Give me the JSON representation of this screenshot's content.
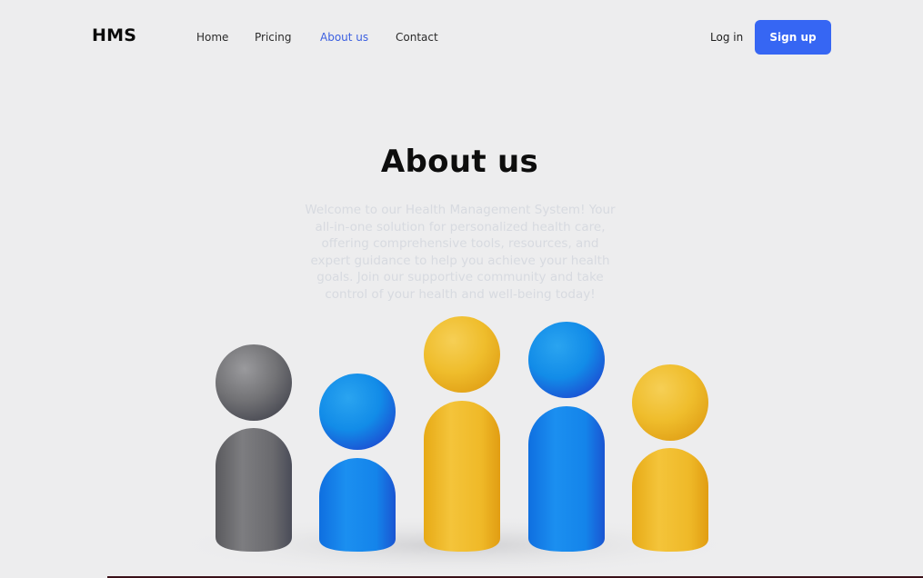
{
  "header": {
    "brand": "HMS",
    "nav": [
      {
        "label": "Home",
        "active": false
      },
      {
        "label": "Pricing",
        "active": false
      },
      {
        "label": "About us",
        "active": true
      },
      {
        "label": "Contact",
        "active": false
      }
    ],
    "login_label": "Log in",
    "signup_label": "Sign up"
  },
  "hero": {
    "title": "About us",
    "description": "Welcome to our Health Management System! Your all-in-one solution for personalized health care, offering comprehensive tools, resources, and expert guidance to help you achieve your health goals. Join our supportive community and take control of your health and well-being today!"
  },
  "illustration": {
    "figures": [
      {
        "name": "gray-person",
        "color": "gray"
      },
      {
        "name": "blue-person",
        "color": "blue"
      },
      {
        "name": "yellow-person",
        "color": "yellow"
      },
      {
        "name": "blue-person",
        "color": "blue"
      },
      {
        "name": "yellow-person",
        "color": "yellow"
      }
    ]
  },
  "colors": {
    "accent": "#3666f3",
    "active_nav": "#3b5fe0",
    "background": "#ededee",
    "gray": "#6f6f72",
    "blue": "#1582ea",
    "yellow": "#f2bd27"
  }
}
